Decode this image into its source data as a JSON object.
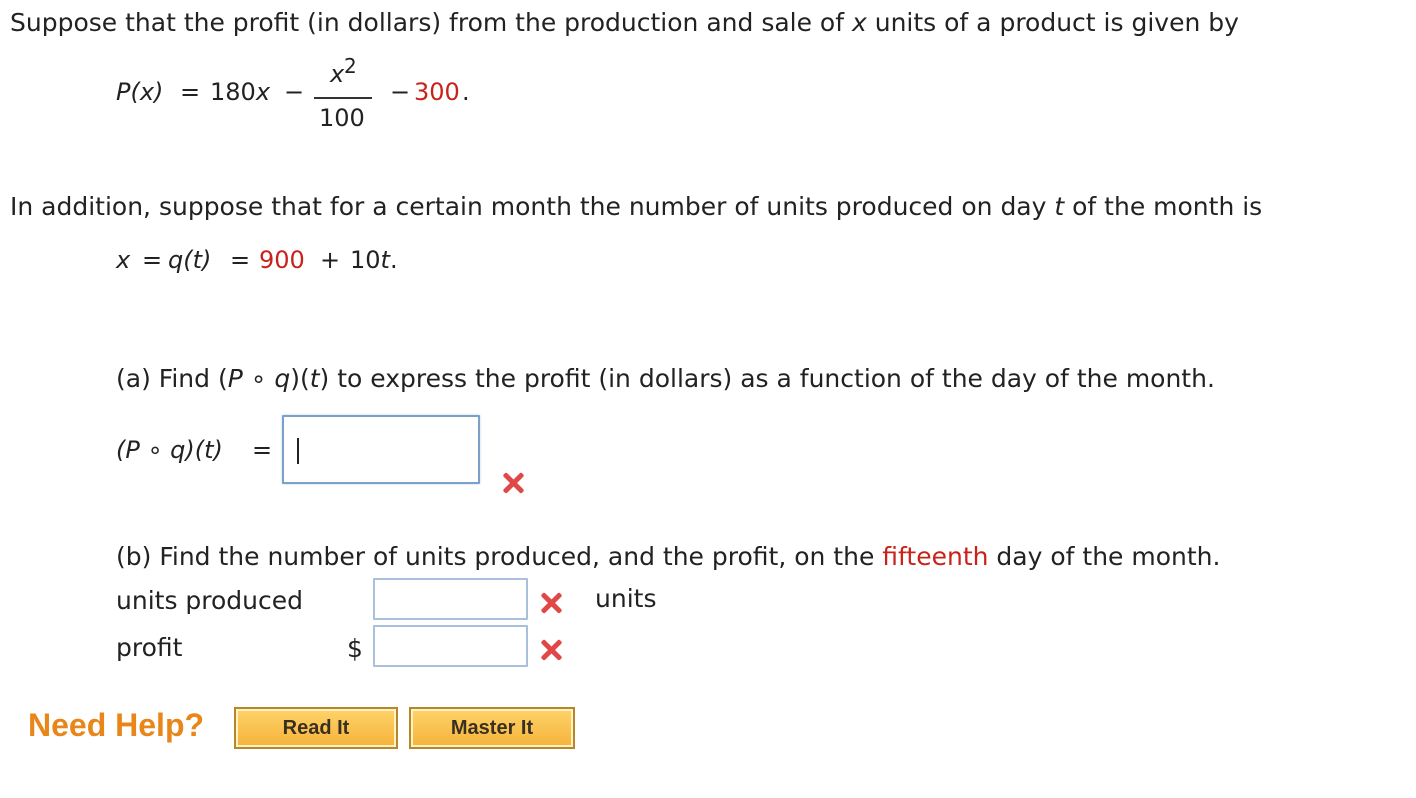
{
  "intro": {
    "line1_pre": "Suppose that the profit (in dollars) from the production and sale of ",
    "line1_var": "x",
    "line1_post": " units of a product is given by"
  },
  "profit_formula": {
    "lhs": "P(x)",
    "eq": "=",
    "term1": "180x",
    "minus1": "−",
    "frac_num": "x",
    "frac_num_exp": "2",
    "frac_den": "100",
    "minus2": "−",
    "constant": "300",
    "period": "."
  },
  "addition": {
    "text_pre": "In addition, suppose that for a certain month the number of units produced on day ",
    "text_var": "t",
    "text_post": " of the month is"
  },
  "production_formula": {
    "x": "x",
    "eq1": "=",
    "q": "q(t)",
    "eq2": "=",
    "value": "900",
    "plus": "+",
    "term": "10t",
    "period": "."
  },
  "part_a": {
    "prompt_pre": "(a) Find (",
    "prompt_mid": "P ∘ q",
    "prompt_paren": ")(",
    "prompt_t": "t",
    "prompt_post": ") to express the profit (in dollars) as a function of the day of the month.",
    "label": "(P ∘ q)(t)",
    "eq": "=",
    "input_value": ""
  },
  "part_b": {
    "prompt_pre": "(b) Find the number of units produced, and the profit, on the ",
    "prompt_highlight": "fifteenth",
    "prompt_post": " day of the month.",
    "units_label": "units produced",
    "units_value": "",
    "units_suffix": "units",
    "profit_label": "profit",
    "profit_prefix": "$",
    "profit_value": ""
  },
  "help": {
    "title": "Need Help?",
    "read_it": "Read It",
    "master_it": "Master It"
  },
  "colors": {
    "highlight_red": "#c8231a",
    "wrong_mark": "#e04848",
    "help_orange": "#e8861a"
  },
  "icons": [
    "wrong-answer-icon"
  ]
}
